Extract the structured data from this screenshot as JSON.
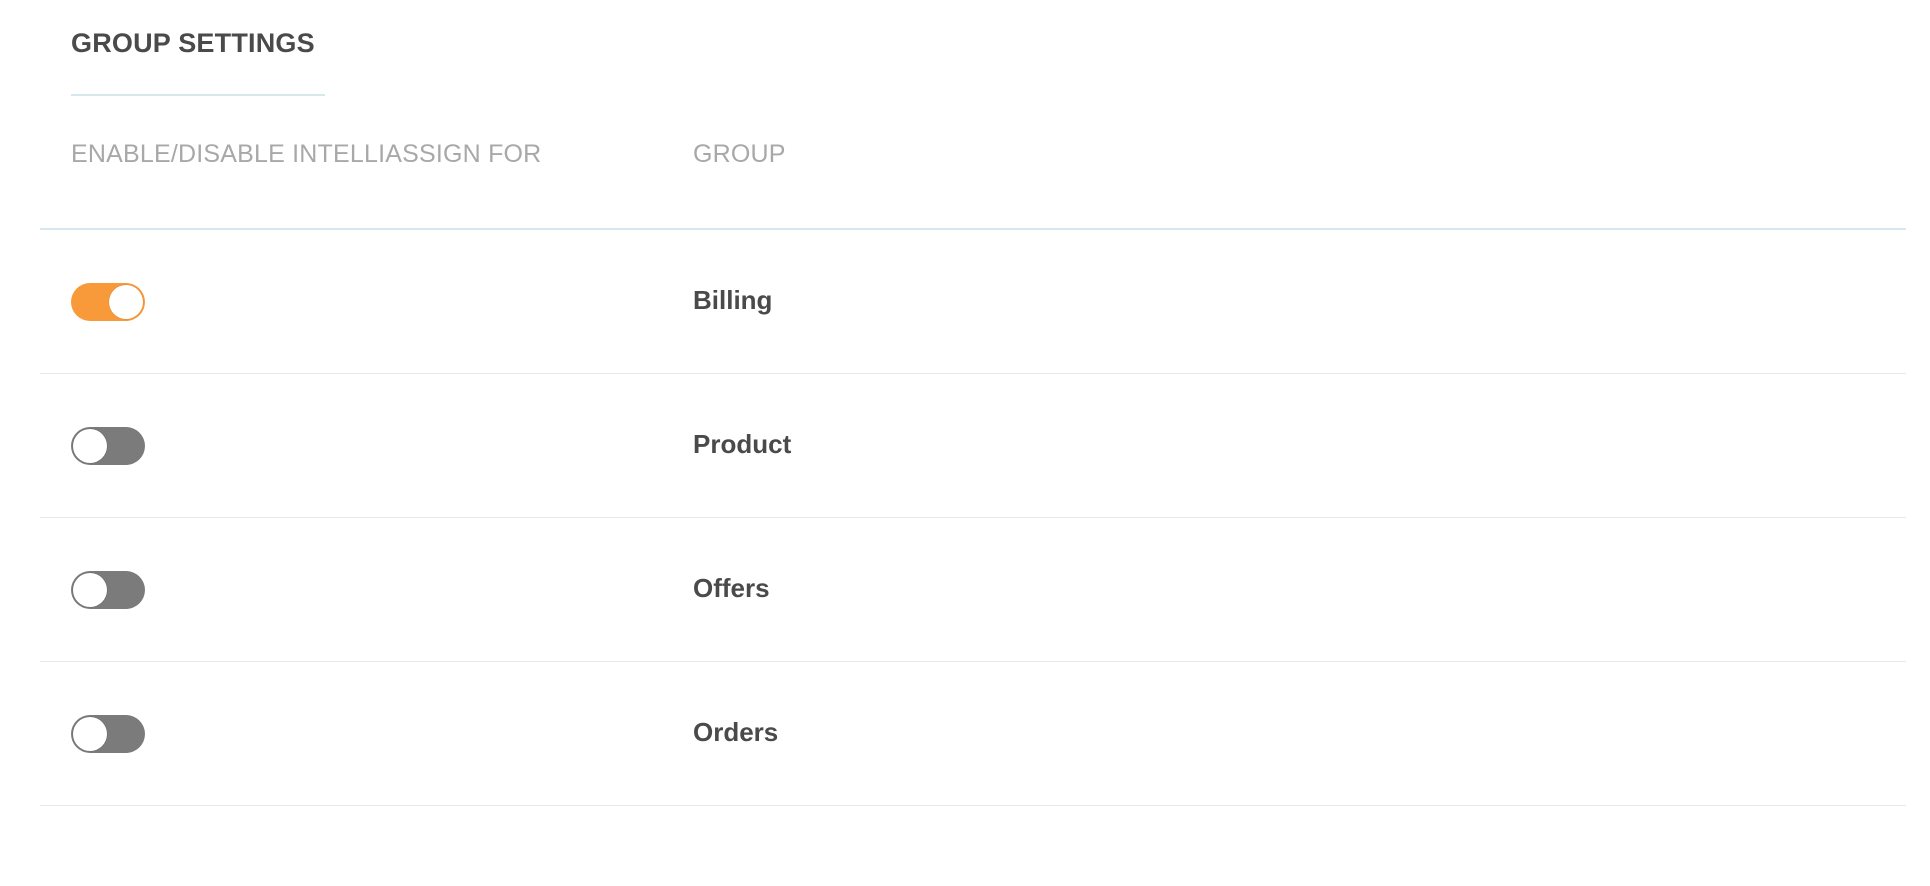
{
  "page": {
    "title": "GROUP SETTINGS"
  },
  "table": {
    "headers": {
      "toggle": "ENABLE/DISABLE INTELLIASSIGN FOR",
      "group": "GROUP"
    },
    "rows": [
      {
        "group": "Billing",
        "enabled": true
      },
      {
        "group": "Product",
        "enabled": false
      },
      {
        "group": "Offers",
        "enabled": false
      },
      {
        "group": "Orders",
        "enabled": false
      }
    ]
  },
  "colors": {
    "toggle_on": "#f89a3a",
    "toggle_off": "#7b7b7b",
    "divider": "#d6e7ee",
    "header_text": "#a8a8a8",
    "body_text": "#4a4a4a"
  }
}
